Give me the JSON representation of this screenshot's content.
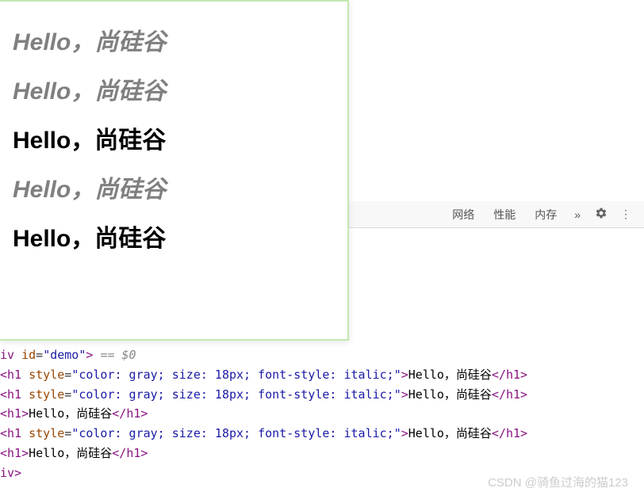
{
  "preview": {
    "h1": "Hello，尚硅谷",
    "h2": "Hello，尚硅谷",
    "h3": "Hello，尚硅谷",
    "h4": "Hello，尚硅谷",
    "h5": "Hello，尚硅谷"
  },
  "devtools": {
    "tab_network": "网络",
    "tab_performance": "性能",
    "tab_memory": "内存",
    "more": "»"
  },
  "code": {
    "line1_open": "iv ",
    "line1_attr": "id",
    "line1_val": "\"demo\"",
    "line1_close": "> ",
    "line1_sel": "== $0",
    "h1_open": "<h1 ",
    "style_attr": "style",
    "style_val": "\"color: gray; size: 18px; font-style: italic;\"",
    "tag_close": ">",
    "text": "Hello，尚硅谷",
    "h1_close": "</h1>",
    "h1_plain_open": "<h1>",
    "div_close": "iv>"
  },
  "watermark": "CSDN @骑鱼过海的猫123"
}
